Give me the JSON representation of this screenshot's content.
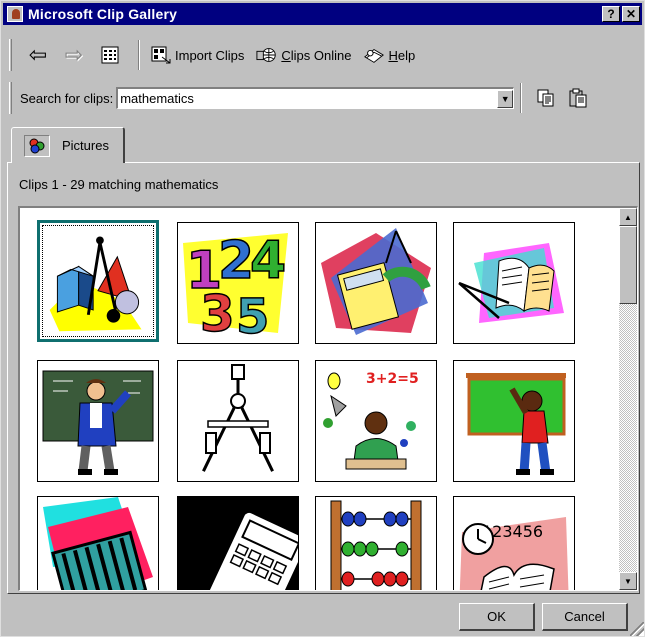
{
  "window": {
    "title": "Microsoft Clip Gallery",
    "help_button": "?",
    "close_button": "✕"
  },
  "toolbar": {
    "back_icon": "⇦",
    "forward_icon": "⇨",
    "import_clips_label": "Import Clips",
    "clips_online_label": "Clips Online",
    "help_label": "Help"
  },
  "search": {
    "label": "Search for clips:",
    "value": "mathematics"
  },
  "tabs": [
    {
      "label": "Pictures"
    }
  ],
  "results": {
    "summary": "Clips 1 - 29 matching mathematics"
  },
  "clips": [
    {
      "subject": "geometry-shapes-compass",
      "selected": true
    },
    {
      "subject": "colorful-numbers"
    },
    {
      "subject": "calculator-protractor"
    },
    {
      "subject": "open-book-compass"
    },
    {
      "subject": "teacher-at-blackboard"
    },
    {
      "subject": "drafting-compass"
    },
    {
      "subject": "student-thinking-numbers",
      "annotation": "3+2=5"
    },
    {
      "subject": "child-at-chalkboard"
    },
    {
      "subject": "abacus-tilted"
    },
    {
      "subject": "calculator"
    },
    {
      "subject": "abacus-beads"
    },
    {
      "subject": "clock-and-book",
      "annotation": "123456"
    }
  ],
  "footer": {
    "ok_label": "OK",
    "cancel_label": "Cancel"
  },
  "colors": {
    "titlebar": "#000080",
    "face": "#c0c0c0",
    "selection_border": "#0f6f6f"
  }
}
